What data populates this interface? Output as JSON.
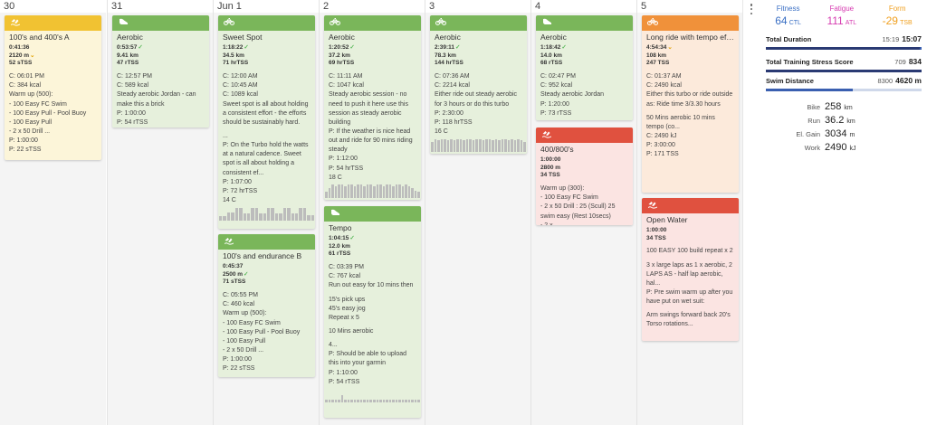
{
  "days": [
    {
      "label": "30",
      "cards": [
        {
          "type": "swim",
          "color": "yellow",
          "title": "100's and 400's A",
          "metrics": [
            "0:41:36",
            "2120 m",
            "52 sTSS"
          ],
          "metric_marks": [
            "",
            "warn",
            ""
          ],
          "lines": [
            "",
            "C: 06:01 PM",
            "C: 384 kcal",
            "Warm up (500):",
            "- 100 Easy FC Swim",
            "- 100 Easy Pull - Pool Buoy",
            "- 100 Easy Pull",
            "- 2 x 50 Drill ...",
            "P: 1:00:00",
            "P: 22 sTSS"
          ]
        }
      ]
    },
    {
      "label": "31",
      "cards": [
        {
          "type": "run",
          "color": "green",
          "title": "Aerobic",
          "metrics": [
            "0:53:57",
            "9.41 km",
            "47 rTSS"
          ],
          "metric_marks": [
            "check",
            "",
            ""
          ],
          "lines": [
            "",
            "C: 12:57 PM",
            "C: 589 kcal",
            "Steady aerobic Jordan - can make this a brick",
            "P: 1:00:00",
            "P: 54 rTSS"
          ]
        }
      ]
    },
    {
      "label": "Jun 1",
      "cards": [
        {
          "type": "bike",
          "color": "green",
          "title": "Sweet Spot",
          "metrics": [
            "1:18:22",
            "34.5 km",
            "71 hrTSS"
          ],
          "metric_marks": [
            "check",
            "",
            ""
          ],
          "lines": [
            "",
            "C: 12:00 AM",
            "C: 10:45 AM",
            "C: 1089 kcal",
            "Sweet spot is all about holding a consistent effort - the efforts should be sustainably hard.",
            "",
            "...",
            "P: On the Turbo hold the watts at a natural cadence. Sweet spot is all about holding a consistent ef...",
            "P: 1:07:00",
            "P: 72 hrTSS",
            "14 C"
          ],
          "spark": [
            3,
            3,
            6,
            6,
            9,
            9,
            5,
            5,
            9,
            9,
            5,
            5,
            9,
            9,
            5,
            5,
            9,
            9,
            5,
            5,
            9,
            9,
            4,
            4
          ]
        },
        {
          "type": "swim",
          "color": "green",
          "title": "100's and endurance B",
          "metrics": [
            "0:45:37",
            "2500 m",
            "71 sTSS"
          ],
          "metric_marks": [
            "",
            "check",
            ""
          ],
          "lines": [
            "",
            "C: 05:55 PM",
            "C: 460 kcal",
            "Warm up (500):",
            "- 100 Easy FC Swim",
            "- 100 Easy Pull - Pool Buoy",
            "- 100 Easy Pull",
            "- 2 x 50 Drill ...",
            "P: 1:00:00",
            "P: 22 sTSS"
          ]
        }
      ]
    },
    {
      "label": "2",
      "cards": [
        {
          "type": "bike",
          "color": "green",
          "title": "Aerobic",
          "metrics": [
            "1:20:52",
            "37.2 km",
            "69 hrTSS"
          ],
          "metric_marks": [
            "check",
            "",
            ""
          ],
          "lines": [
            "",
            "C: 11:11 AM",
            "C: 1047 kcal",
            "Steady aerobic session - no need to push it here use this session as steady aerobic building",
            "P: If the weather is nice head out and ride for 90 mins riding steady",
            "P: 1:12:00",
            "P: 54 hrTSS",
            "18 C"
          ],
          "spark": [
            4,
            7,
            9,
            8,
            9,
            9,
            8,
            9,
            9,
            8,
            9,
            9,
            8,
            9,
            9,
            8,
            9,
            9,
            8,
            9,
            9,
            8,
            9,
            9,
            8,
            9,
            8,
            7,
            5,
            4
          ]
        },
        {
          "type": "run",
          "color": "green",
          "title": "Tempo",
          "metrics": [
            "1:04:15",
            "12.0 km",
            "61 rTSS"
          ],
          "metric_marks": [
            "check",
            "",
            ""
          ],
          "lines": [
            "",
            "C: 03:39 PM",
            "C: 767 kcal",
            "Run out easy for 10 mins then",
            "",
            "15's pick ups",
            "45's easy jog",
            "Repeat x 5",
            "",
            "10 Mins aerobic",
            "",
            "4...",
            "P: Should be able to upload this into your garmin",
            "P: 1:10:00",
            "P: 54 rTSS"
          ],
          "spark": [
            2,
            2,
            2,
            2,
            2,
            5,
            2,
            2,
            2,
            2,
            2,
            2,
            2,
            2,
            2,
            2,
            2,
            2,
            2,
            2,
            2,
            2,
            2,
            2,
            2,
            2,
            2,
            2,
            2,
            2
          ]
        }
      ]
    },
    {
      "label": "3",
      "cards": [
        {
          "type": "bike",
          "color": "green",
          "title": "Aerobic",
          "metrics": [
            "2:39:11",
            "78.3 km",
            "144 hrTSS"
          ],
          "metric_marks": [
            "check",
            "",
            ""
          ],
          "lines": [
            "",
            "C: 07:36 AM",
            "C: 2214 kcal",
            "Either ride out steady aerobic for 3 hours or do this turbo",
            "P: 2:30:00",
            "P: 118 hrTSS",
            "16 C"
          ],
          "spark": [
            7,
            9,
            8,
            9,
            9,
            8,
            9,
            8,
            9,
            9,
            8,
            9,
            9,
            8,
            9,
            9,
            8,
            9,
            9,
            8,
            9,
            8,
            9,
            9,
            8,
            9,
            8,
            9,
            8,
            7
          ]
        }
      ]
    },
    {
      "label": "4",
      "cards": [
        {
          "type": "run",
          "color": "green",
          "title": "Aerobic",
          "metrics": [
            "1:18:42",
            "14.0 km",
            "68 rTSS"
          ],
          "metric_marks": [
            "check",
            "",
            ""
          ],
          "lines": [
            "",
            "C: 02:47 PM",
            "C: 952 kcal",
            "Steady aerobic Jordan",
            "P: 1:20:00",
            "P: 73 rTSS"
          ]
        },
        {
          "type": "swim",
          "color": "red",
          "title": "400/800's",
          "metrics": [
            "1:00:00",
            "2800 m",
            "34 TSS"
          ],
          "metric_marks": [
            "",
            "",
            ""
          ],
          "lines": [
            "",
            "Warm up (300):",
            "- 100 Easy FC Swim",
            "- 2 x 50 Drill : 25 (Scull) 25 swim easy (Rest 10secs)",
            "- 2 x..."
          ]
        }
      ]
    },
    {
      "label": "5",
      "cards": [
        {
          "type": "bike",
          "color": "orange",
          "title": "Long ride with tempo effo...",
          "metrics": [
            "4:54:34",
            "108 km",
            "247 TSS"
          ],
          "metric_marks": [
            "warn",
            "",
            ""
          ],
          "lines": [
            "",
            "C: 01:37 AM",
            "C: 2490 kcal",
            "Either this turbo or ride outside as: Ride time 3/3.30 hours",
            "",
            "50 Mins aerobic 10 mins tempo (co...",
            "C: 2490 kJ",
            "P: 3:00:00",
            "P: 171 TSS"
          ]
        },
        {
          "type": "swim",
          "color": "red",
          "title": "Open Water",
          "metrics": [
            "1:00:00",
            "34 TSS"
          ],
          "metric_marks": [
            "",
            ""
          ],
          "lines": [
            "",
            "100 EASY 100 build repeat x 2",
            "",
            "3 x large laps as 1 x aerobic, 2 LAPS AS - half lap aerobic, hal...",
            "P: Pre swim warm up after you have put on wet suit:",
            "",
            "Arm swings forward back 20's Torso rotations..."
          ]
        }
      ]
    }
  ],
  "sidebar": {
    "fitness": {
      "label": "Fitness",
      "value": "64",
      "unit": "CTL",
      "color": "#3a6fc4"
    },
    "fatigue": {
      "label": "Fatigue",
      "value": "111",
      "unit": "ATL",
      "color": "#d63bb0"
    },
    "form": {
      "label": "Form",
      "value": "-29",
      "unit": "TSB",
      "color": "#f0a020"
    },
    "total_duration": {
      "label": "Total Duration",
      "planned": "15:19",
      "completed": "15:07",
      "progress": 0.99
    },
    "tss": {
      "label": "Total Training Stress Score",
      "planned": "709",
      "completed": "834",
      "progress": 1.0
    },
    "swim_distance": {
      "label": "Swim Distance",
      "planned": "8300",
      "completed": "4620 m",
      "progress": 0.56
    },
    "sports": [
      {
        "label": "Bike",
        "value": "258",
        "unit": "km"
      },
      {
        "label": "Run",
        "value": "36.2",
        "unit": "km"
      },
      {
        "label": "El. Gain",
        "value": "3034",
        "unit": "m"
      },
      {
        "label": "Work",
        "value": "2490",
        "unit": "kJ"
      }
    ]
  }
}
